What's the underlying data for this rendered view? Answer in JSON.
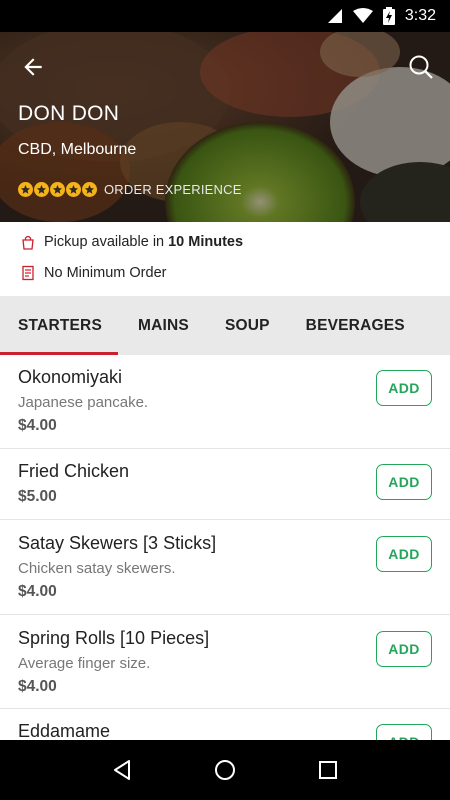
{
  "status_bar": {
    "time": "3:32",
    "battery_icon": "battery-charging-icon",
    "wifi_icon": "wifi-icon",
    "signal_icon": "signal-icon"
  },
  "header": {
    "title": "DON DON",
    "location": "CBD, Melbourne",
    "rating_stars": 5,
    "rating_label": "ORDER EXPERIENCE",
    "back_icon": "back-arrow-icon",
    "search_icon": "search-icon"
  },
  "info": {
    "pickup_prefix": "Pickup available in",
    "pickup_time": "10 Minutes",
    "minimum_order": "No Minimum Order"
  },
  "tabs": [
    {
      "label": "STARTERS",
      "active": true
    },
    {
      "label": "MAINS",
      "active": false
    },
    {
      "label": "SOUP",
      "active": false
    },
    {
      "label": "BEVERAGES",
      "active": false
    }
  ],
  "menu_items": [
    {
      "name": "Okonomiyaki",
      "description": "Japanese pancake.",
      "price": "$4.00",
      "add_label": "ADD"
    },
    {
      "name": "Fried Chicken",
      "description": "",
      "price": "$5.00",
      "add_label": "ADD"
    },
    {
      "name": "Satay Skewers [3 Sticks]",
      "description": "Chicken satay skewers.",
      "price": "$4.00",
      "add_label": "ADD"
    },
    {
      "name": "Spring Rolls [10 Pieces]",
      "description": "Average finger size.",
      "price": "$4.00",
      "add_label": "ADD"
    },
    {
      "name": "Eddamame",
      "description": "",
      "price": "",
      "add_label": "ADD"
    }
  ],
  "colors": {
    "accent": "#cb202d",
    "add_green": "#23a55a",
    "star": "#f6b21b"
  }
}
